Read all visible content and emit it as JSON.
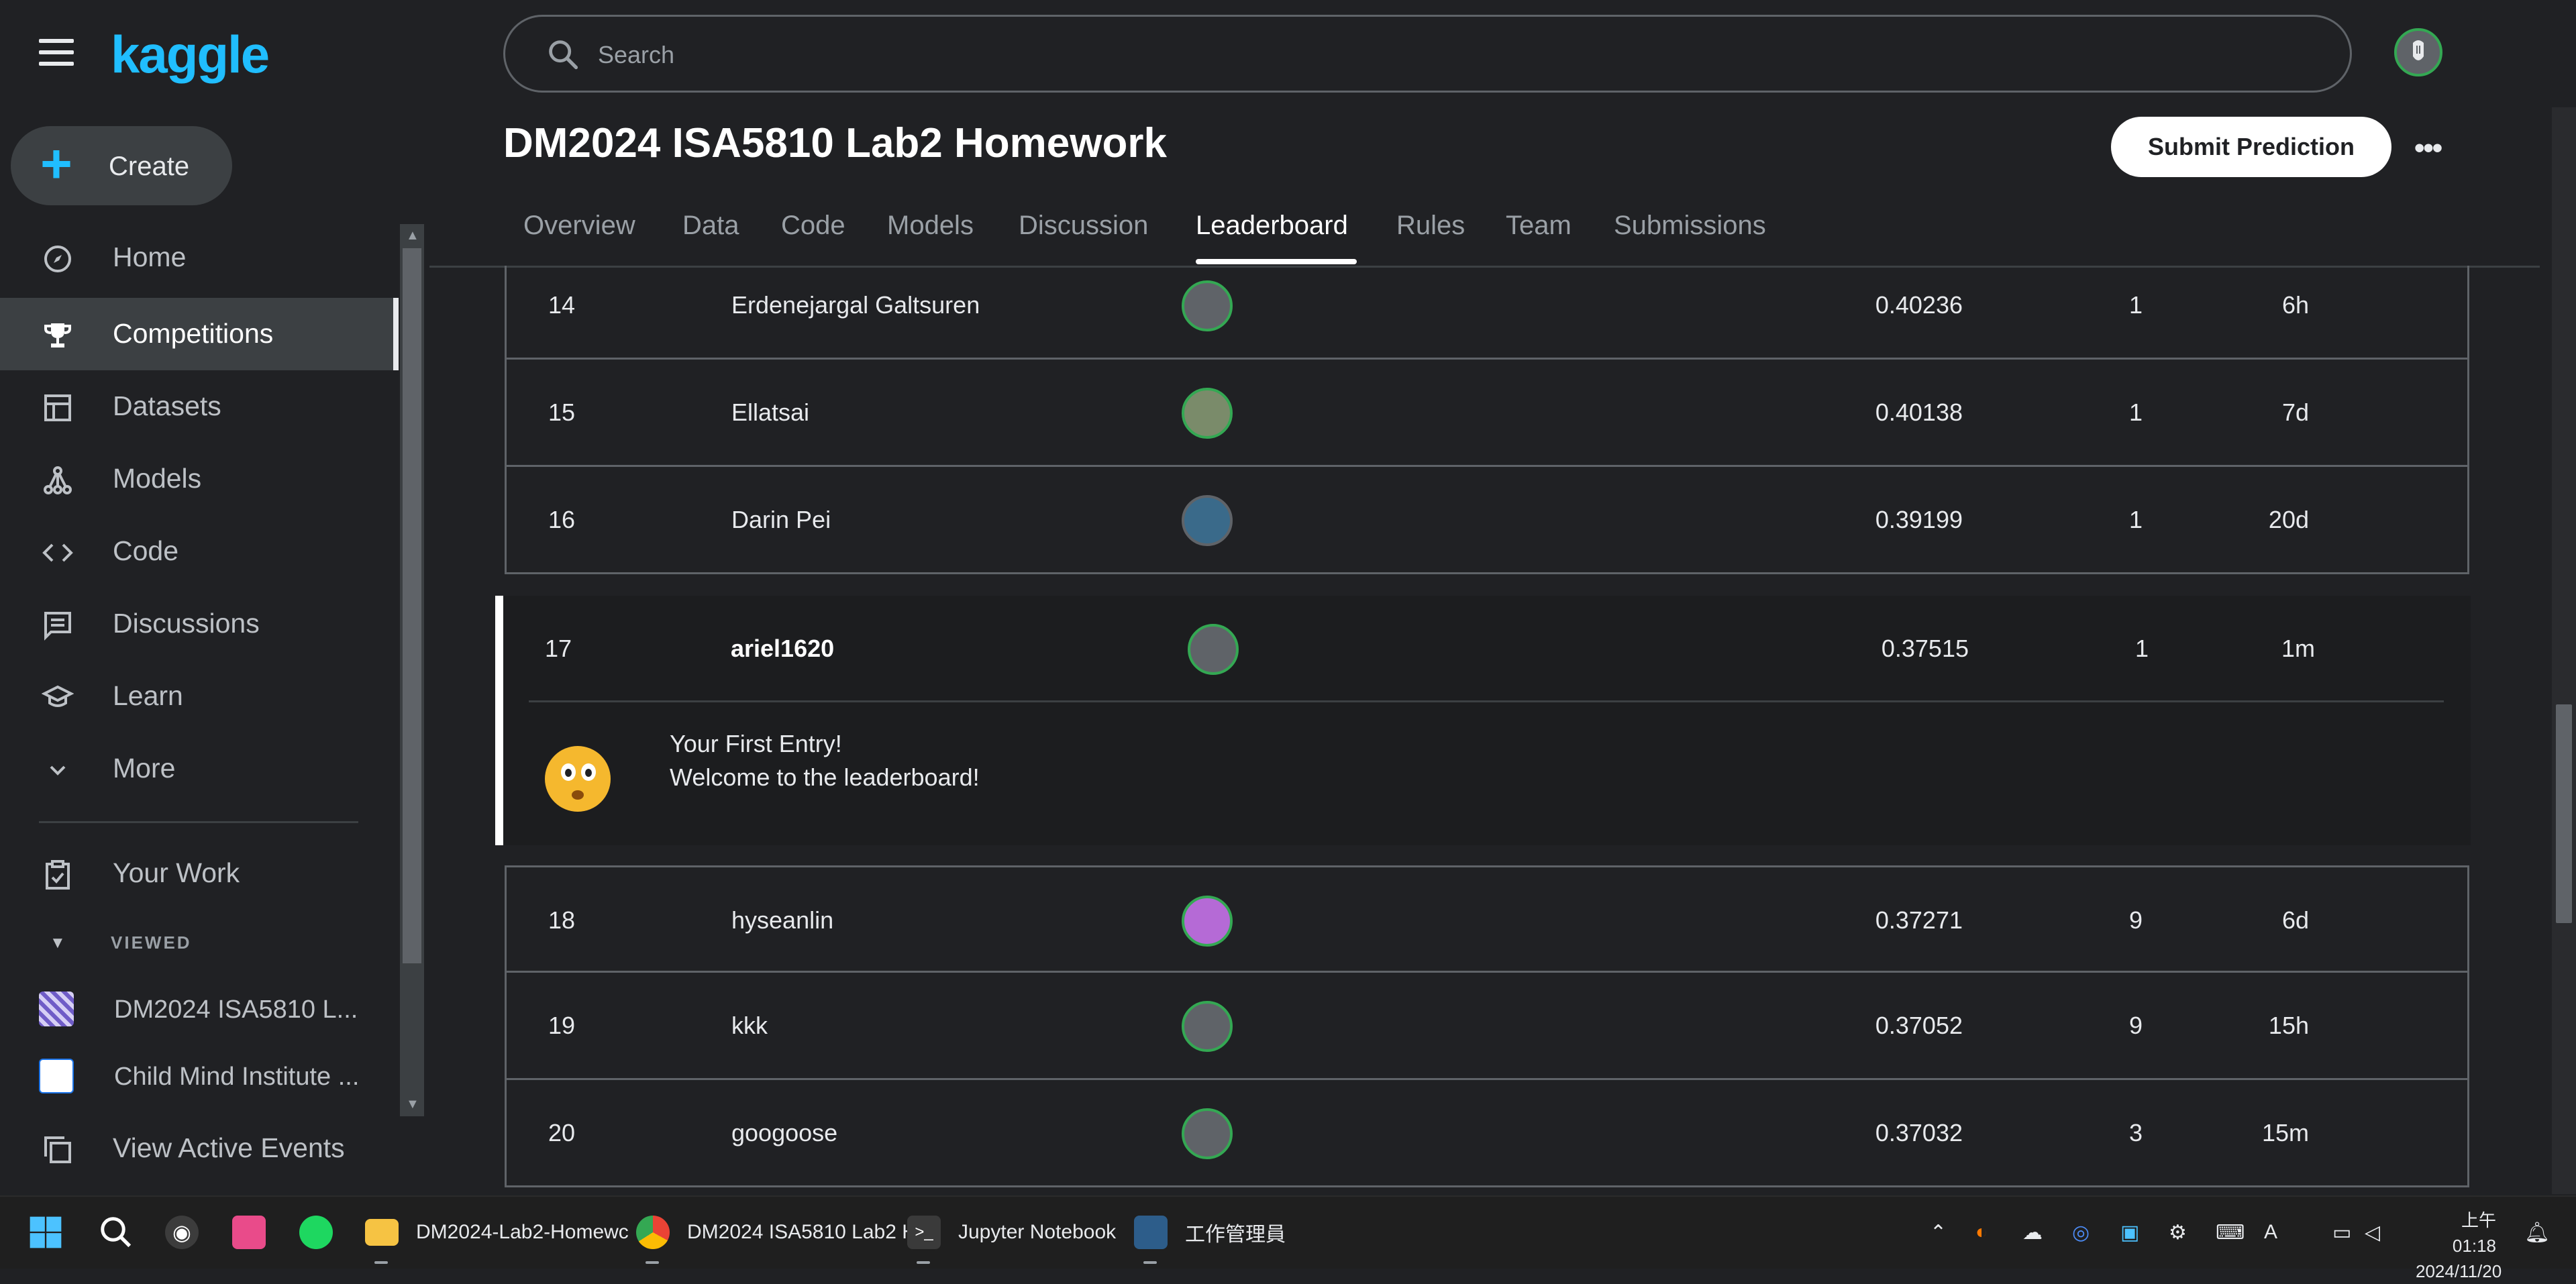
{
  "app": {
    "logo": "kaggle",
    "search_placeholder": "Search"
  },
  "sidebar": {
    "create_label": "Create",
    "items": [
      {
        "label": "Home",
        "icon": "home-icon"
      },
      {
        "label": "Competitions",
        "icon": "trophy-icon",
        "active": true
      },
      {
        "label": "Datasets",
        "icon": "table-icon"
      },
      {
        "label": "Models",
        "icon": "models-icon"
      },
      {
        "label": "Code",
        "icon": "code-icon"
      },
      {
        "label": "Discussions",
        "icon": "discussion-icon"
      },
      {
        "label": "Learn",
        "icon": "learn-icon"
      },
      {
        "label": "More",
        "icon": "chevron-down-icon"
      }
    ],
    "your_work": "Your Work",
    "viewed_header": "VIEWED",
    "viewed": [
      {
        "label": "DM2024 ISA5810 L..."
      },
      {
        "label": "Child Mind Institute ..."
      }
    ],
    "view_active_events": "View Active Events"
  },
  "competition": {
    "title": "DM2024 ISA5810 Lab2 Homework",
    "submit_label": "Submit Prediction",
    "more_label": "•••",
    "tabs": [
      "Overview",
      "Data",
      "Code",
      "Models",
      "Discussion",
      "Leaderboard",
      "Rules",
      "Team",
      "Submissions"
    ],
    "active_tab": "Leaderboard"
  },
  "leaderboard": {
    "rows": [
      {
        "rank": "14",
        "name": "Erdenejargal Galtsuren",
        "score": "0.40236",
        "entries": "1",
        "last": "6h"
      },
      {
        "rank": "15",
        "name": "Ellatsai",
        "score": "0.40138",
        "entries": "1",
        "last": "7d"
      },
      {
        "rank": "16",
        "name": "Darin Pei",
        "score": "0.39199",
        "entries": "1",
        "last": "20d"
      },
      {
        "rank": "17",
        "name": "ariel1620",
        "score": "0.37515",
        "entries": "1",
        "last": "1m",
        "me": true
      },
      {
        "rank": "18",
        "name": "hyseanlin",
        "score": "0.37271",
        "entries": "9",
        "last": "6d"
      },
      {
        "rank": "19",
        "name": "kkk",
        "score": "0.37052",
        "entries": "9",
        "last": "15h"
      },
      {
        "rank": "20",
        "name": "googoose",
        "score": "0.37032",
        "entries": "3",
        "last": "15m"
      }
    ],
    "first_entry_title": "Your First Entry!",
    "first_entry_msg": "Welcome to the leaderboard!"
  },
  "taskbar": {
    "apps": [
      {
        "label": "DM2024-Lab2-Homewc",
        "icon": "folder-icon"
      },
      {
        "label": "DM2024 ISA5810 Lab2 H",
        "icon": "chrome-icon"
      },
      {
        "label": "Jupyter Notebook",
        "icon": "terminal-icon"
      },
      {
        "label": "工作管理員",
        "icon": "task-manager-icon"
      }
    ],
    "clock_time": "上午 01:18",
    "clock_date": "2024/11/20"
  },
  "colors": {
    "accent": "#20beff",
    "background": "#202124",
    "active_nav": "#3c4043"
  }
}
